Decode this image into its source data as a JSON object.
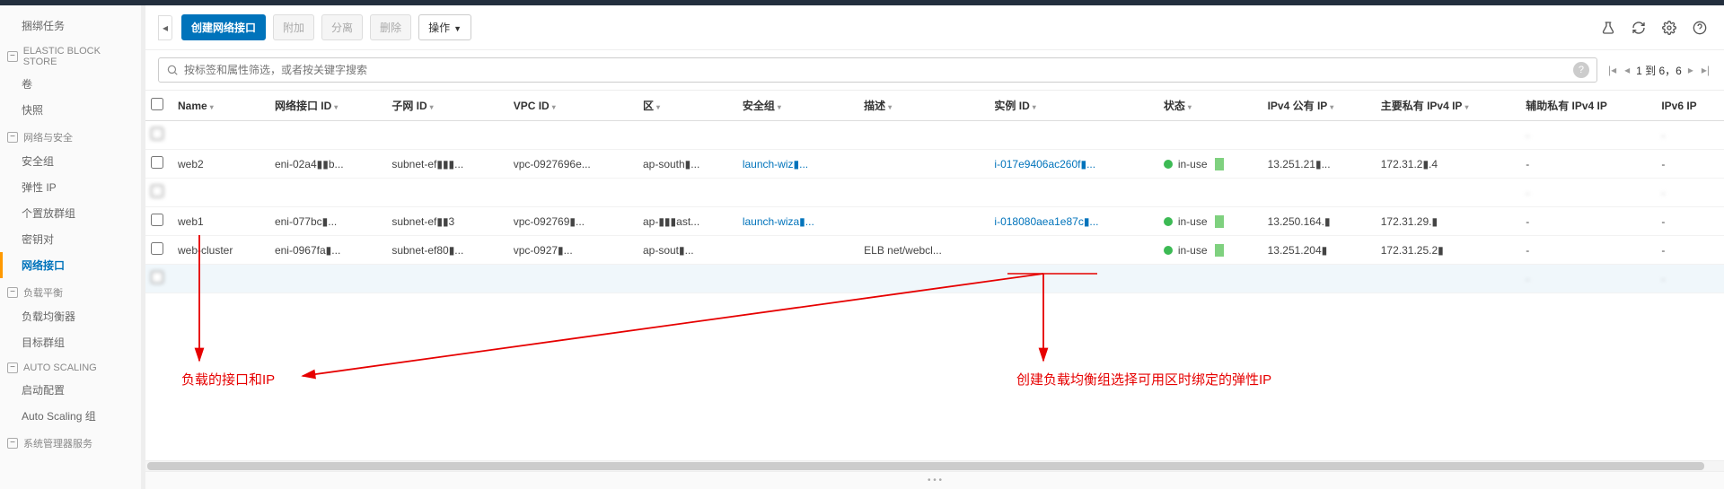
{
  "sidebar": {
    "items0": [
      "捆绑任务"
    ],
    "group_ebs": "ELASTIC BLOCK STORE",
    "items_ebs": [
      "卷",
      "快照"
    ],
    "group_net": "网络与安全",
    "items_net": [
      "安全组",
      "弹性 IP",
      "个置放群组",
      "密钥对",
      "网络接口"
    ],
    "group_lb": "负载平衡",
    "items_lb": [
      "负载均衡器",
      "目标群组"
    ],
    "group_as": "AUTO SCALING",
    "items_as": [
      "启动配置",
      "Auto Scaling 组"
    ],
    "group_sys": "系统管理器服务"
  },
  "toolbar": {
    "create": "创建网络接口",
    "attach": "附加",
    "detach": "分离",
    "delete": "删除",
    "actions": "操作"
  },
  "search": {
    "placeholder": "按标签和属性筛选，或者按关键字搜索"
  },
  "pager": {
    "text": "1 到 6，6"
  },
  "columns": [
    "Name",
    "网络接口 ID",
    "子网 ID",
    "VPC ID",
    "区",
    "安全组",
    "描述",
    "实例 ID",
    "状态",
    "IPv4 公有 IP",
    "主要私有 IPv4 IP",
    "辅助私有 IPv4 IP",
    "IPv6 IP"
  ],
  "rows": [
    {
      "blur": true,
      "name": "",
      "eni": "",
      "subnet": "",
      "vpc": "",
      "zone": "",
      "sg": "",
      "desc": "",
      "inst": "",
      "status": "",
      "ip4pub": "",
      "ip4priv": "",
      "ip4aux": "-",
      "ip6": "-"
    },
    {
      "blur": false,
      "name": "web2",
      "eni": "eni-02a4▮▮b...",
      "subnet": "subnet-ef▮▮▮...",
      "vpc": "vpc-0927696e...",
      "zone": "ap-south▮...",
      "sg": "launch-wiz▮...",
      "desc": "",
      "inst": "i-017e9406ac260f▮...",
      "status": "in-use",
      "ip4pub": "13.251.21▮...",
      "ip4priv": "172.31.2▮.4",
      "ip4aux": "-",
      "ip6": "-"
    },
    {
      "blur": true,
      "name": "",
      "eni": "",
      "subnet": "",
      "vpc": "",
      "zone": "",
      "sg": "",
      "desc": "",
      "inst": "",
      "status": "",
      "ip4pub": "",
      "ip4priv": "",
      "ip4aux": "-",
      "ip6": "-"
    },
    {
      "blur": false,
      "name": "web1",
      "eni": "eni-077bc▮...",
      "subnet": "subnet-ef▮▮3",
      "vpc": "vpc-092769▮...",
      "zone": "ap-▮▮▮ast...",
      "sg": "launch-wiza▮...",
      "desc": "",
      "inst": "i-018080aea1e87c▮...",
      "status": "in-use",
      "ip4pub": "13.250.164.▮",
      "ip4priv": "172.31.29.▮",
      "ip4aux": "-",
      "ip6": "-"
    },
    {
      "blur": false,
      "name": "web-cluster",
      "eni": "eni-0967fa▮...",
      "subnet": "subnet-ef80▮...",
      "vpc": "vpc-0927▮...",
      "zone": "ap-sout▮...",
      "sg": "",
      "desc": "ELB net/webcl...",
      "inst": "",
      "status": "in-use",
      "ip4pub": "13.251.204▮",
      "ip4priv": "172.31.25.2▮",
      "ip4aux": "-",
      "ip6": "-"
    },
    {
      "blur": true,
      "sel": true,
      "name": "",
      "eni": "",
      "subnet": "",
      "vpc": "",
      "zone": "",
      "sg": "",
      "desc": "",
      "inst": "",
      "status": "",
      "ip4pub": "",
      "ip4priv": "",
      "ip4aux": "-",
      "ip6": "-"
    }
  ],
  "anno": {
    "left": "负载的接口和IP",
    "right": "创建负载均衡组选择可用区时绑定的弹性IP"
  }
}
